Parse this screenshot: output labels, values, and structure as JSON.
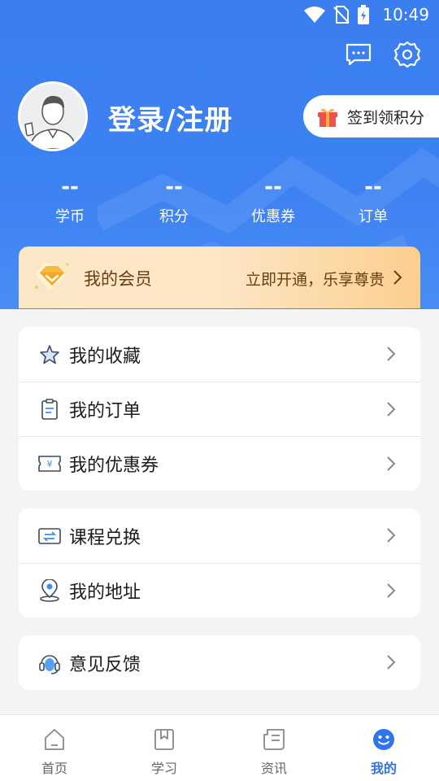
{
  "status_bar": {
    "time": "10:49"
  },
  "header": {
    "login_label": "登录/注册",
    "signin_label": "签到领积分"
  },
  "stats": [
    {
      "value": "--",
      "label": "学币"
    },
    {
      "value": "--",
      "label": "积分"
    },
    {
      "value": "--",
      "label": "优惠券"
    },
    {
      "value": "--",
      "label": "订单"
    }
  ],
  "vip": {
    "title": "我的会员",
    "cta": "立即开通，乐享尊贵"
  },
  "menu_groups": [
    [
      {
        "label": "我的收藏",
        "icon": "star-icon"
      },
      {
        "label": "我的订单",
        "icon": "clipboard-icon"
      },
      {
        "label": "我的优惠券",
        "icon": "coupon-icon"
      }
    ],
    [
      {
        "label": "课程兑换",
        "icon": "exchange-icon"
      },
      {
        "label": "我的地址",
        "icon": "location-icon"
      }
    ],
    [
      {
        "label": "意见反馈",
        "icon": "headset-icon"
      }
    ]
  ],
  "tabbar": [
    {
      "label": "首页",
      "icon": "home-icon",
      "active": false
    },
    {
      "label": "学习",
      "icon": "bookmark-icon",
      "active": false
    },
    {
      "label": "资讯",
      "icon": "news-icon",
      "active": false
    },
    {
      "label": "我的",
      "icon": "smiley-icon",
      "active": true
    }
  ],
  "colors": {
    "brand_blue": "#3d82f2",
    "active_tab": "#2f74ea",
    "vip_text": "#6b3d12",
    "gift_red": "#f0524b"
  }
}
